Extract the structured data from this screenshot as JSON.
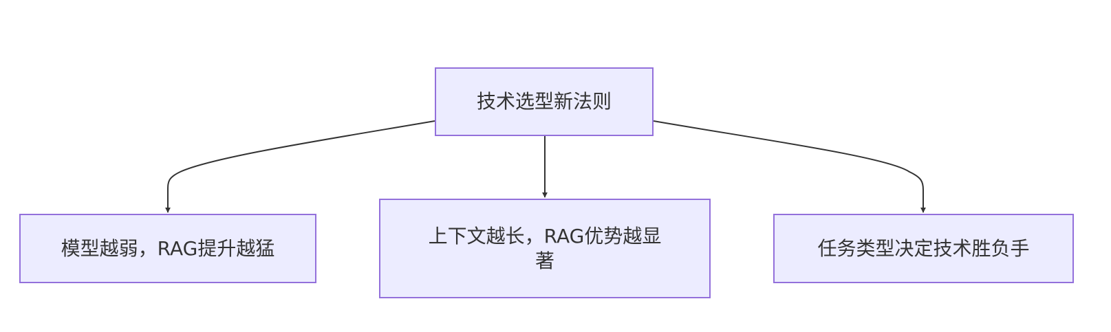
{
  "diagram": {
    "type": "flowchart",
    "colors": {
      "node_fill": "#ececff",
      "node_border": "#9370db",
      "edge": "#333333",
      "text": "#333333"
    },
    "root": {
      "label": "技术选型新法则"
    },
    "children": [
      {
        "label": "模型越弱，RAG提升越猛"
      },
      {
        "label_line1": "上下文越长，RAG优势越显",
        "label_line2": "著"
      },
      {
        "label": "任务类型决定技术胜负手"
      }
    ]
  }
}
